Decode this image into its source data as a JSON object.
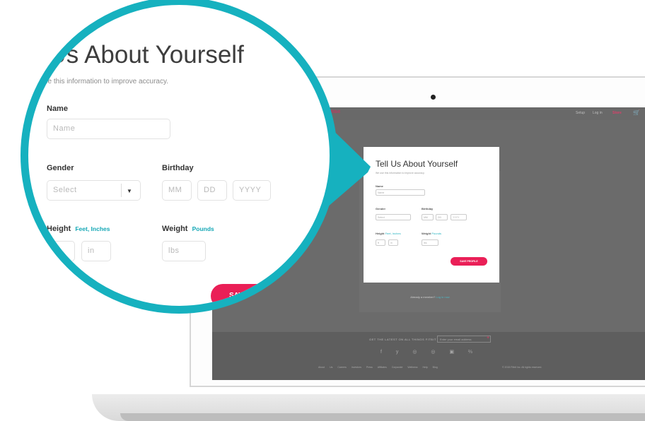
{
  "modal": {
    "title": "Tell Us About Yourself",
    "subtitle": "We use this information to improve accuracy.",
    "name_label": "Name",
    "name_placeholder": "Name",
    "gender_label": "Gender",
    "gender_placeholder": "Select",
    "birthday_label": "Birthday",
    "month_placeholder": "MM",
    "day_placeholder": "DD",
    "year_placeholder": "YYYY",
    "height_label": "Height",
    "height_unit": "Feet, Inches",
    "feet_placeholder": "ft",
    "inches_placeholder": "in",
    "weight_label": "Weight",
    "weight_unit": "Pounds",
    "weight_placeholder": "lbs",
    "save_label": "SAVE PROFILE"
  },
  "magnifier": {
    "title": "l Us About Yourself",
    "subtitle": "use this information to improve accuracy.",
    "save_label": "SAVE PRO"
  },
  "screen": {
    "logo": "fitbit",
    "nav": [
      "Setup",
      "Log in",
      "Store"
    ],
    "already_text": "Already a member?",
    "already_link": "Log in now",
    "footer_subscribe": "GET THE LATEST ON ALL THINGS FITBIT",
    "footer_email_placeholder": "Enter your email address",
    "footer_links": "About Us  Careers  Investors  Press  Affiliates  Corporate Wellness  Help  Blog",
    "footer_copyright": "© 2015 Fitbit Inc. All rights reserved."
  },
  "colors": {
    "accent_teal": "#16b1bf",
    "save_pink": "#ea1f57",
    "screen_gray": "#6b6b6b"
  }
}
